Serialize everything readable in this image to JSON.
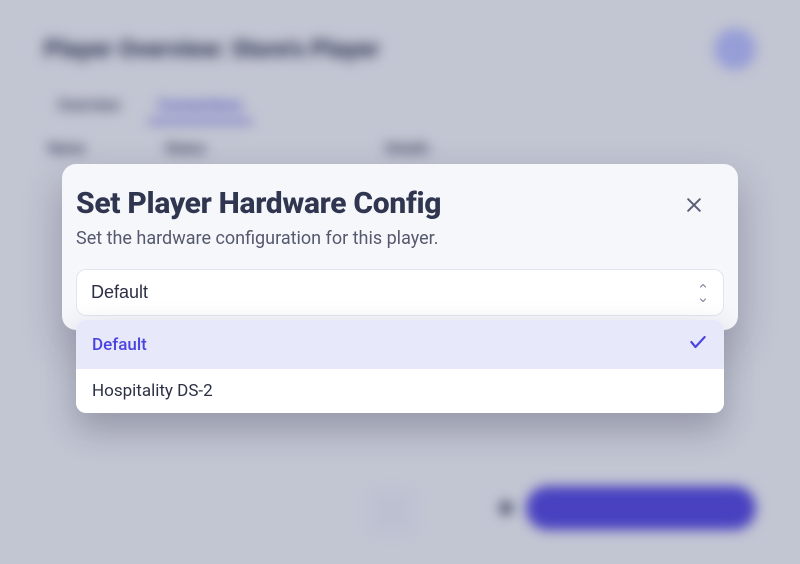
{
  "background": {
    "page_title": "Player Overview: Store's Player",
    "tabs": {
      "overview": "Overview",
      "connections": "Connections"
    },
    "cols": {
      "name": "Name",
      "status": "Status",
      "details": "Details"
    }
  },
  "modal": {
    "title": "Set Player Hardware Config",
    "subtitle": "Set the hardware configuration for this player.",
    "select": {
      "value": "Default",
      "options": [
        {
          "label": "Default",
          "selected": true
        },
        {
          "label": "Hospitality DS-2",
          "selected": false
        }
      ]
    }
  },
  "colors": {
    "accent": "#4b45e0",
    "text_dark": "#303650",
    "text_muted": "#55596e",
    "option_selected_bg": "#e7e9fb"
  }
}
